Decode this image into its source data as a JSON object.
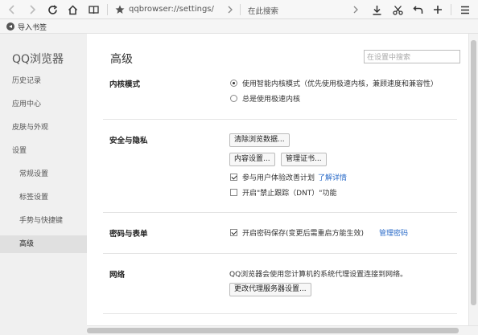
{
  "toolbar": {
    "address": "qqbrowser://settings/",
    "search_placeholder": "在此搜索"
  },
  "bookmark_bar": {
    "import_label": "导入书签"
  },
  "sidebar": {
    "title": "QQ浏览器",
    "items": [
      {
        "label": "历史记录"
      },
      {
        "label": "应用中心"
      },
      {
        "label": "皮肤与外观"
      },
      {
        "label": "设置"
      },
      {
        "label": "常规设置"
      },
      {
        "label": "标签设置"
      },
      {
        "label": "手势与快捷键"
      },
      {
        "label": "高级"
      }
    ]
  },
  "main": {
    "title": "高级",
    "search_placeholder": "在设置中搜索",
    "kernel": {
      "label": "内核模式",
      "option1": "使用智能内核模式（优先使用极速内核，兼顾速度和兼容性）",
      "option2": "总是使用极速内核",
      "selected": 1
    },
    "security": {
      "label": "安全与隐私",
      "clear_button": "清除浏览数据...",
      "content_button": "内容设置...",
      "cert_button": "管理证书...",
      "improve_label": "参与用户体验改善计划",
      "improve_checked": true,
      "learn_more": "了解详情",
      "dnt_label": "开启\"禁止跟踪（DNT）\"功能",
      "dnt_checked": false
    },
    "password": {
      "label": "密码与表单",
      "save_label": "开启密码保存(变更后需重启方能生效)",
      "save_checked": true,
      "manage_link": "管理密码"
    },
    "network": {
      "label": "网络",
      "description": "QQ浏览器会使用您计算机的系统代理设置连接到网络。",
      "proxy_button": "更改代理服务器设置..."
    }
  },
  "colors": {
    "link": "#2a6bc8",
    "sidebar_bg": "#f0f0f0",
    "active_item_bg": "#e0e0e0"
  }
}
